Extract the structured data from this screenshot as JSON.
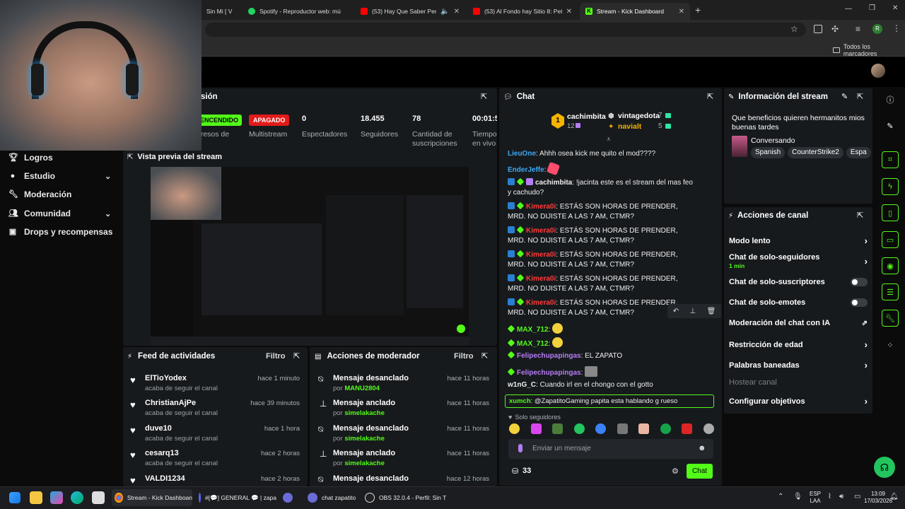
{
  "browser": {
    "tabs": [
      {
        "label": "Sin Mi [ V"
      },
      {
        "label": "Spotify - Reproductor web: mú"
      },
      {
        "label": "(53) Hay Que Saber Perder"
      },
      {
        "label": "(53) Al Fondo hay Sitio 8: Peter"
      },
      {
        "label": "Stream - Kick Dashboard"
      }
    ],
    "new_tab": "+",
    "bookmarks_folder": "Todos los marcadores",
    "profile_initial": "R"
  },
  "nav": {
    "items": [
      {
        "label": "Logros"
      },
      {
        "label": "Estudio"
      },
      {
        "label": "Moderación"
      },
      {
        "label": "Comunidad"
      },
      {
        "label": "Drops y recompensas"
      }
    ]
  },
  "session": {
    "title": "sión",
    "stats": [
      {
        "value": "ENCENDIDO",
        "label": "gresos de"
      },
      {
        "value": "APAGADO",
        "label": "Multistream"
      },
      {
        "value": "0",
        "label": "Espectadores"
      },
      {
        "value": "18.455",
        "label": "Seguidores"
      },
      {
        "value": "78",
        "label": "Cantidad de suscripciones"
      },
      {
        "value": "00:01:5",
        "label": "Tiempo en vivo"
      }
    ]
  },
  "preview": {
    "title": "Vista previa del stream"
  },
  "feed": {
    "title": "Feed de actividades",
    "filter": "Filtro",
    "items": [
      {
        "name": "ElTioYodex",
        "action": "acaba de seguir el canal",
        "time": "hace 1 minuto"
      },
      {
        "name": "ChristianAjPe",
        "action": "acaba de seguir el canal",
        "time": "hace 39 minutos"
      },
      {
        "name": "duve10",
        "action": "acaba de seguir el canal",
        "time": "hace 1 hora"
      },
      {
        "name": "cesarq13",
        "action": "acaba de seguir el canal",
        "time": "hace 2 horas"
      },
      {
        "name": "VALDI1234",
        "action": "",
        "time": "hace 2 horas"
      }
    ]
  },
  "modactions": {
    "title": "Acciones de moderador",
    "filter": "Filtro",
    "items": [
      {
        "action": "Mensaje desanclado",
        "prefix": "por",
        "user": "MANU2804",
        "time": "hace 11 horas"
      },
      {
        "action": "Mensaje anclado",
        "prefix": "por",
        "user": "simelakache",
        "time": "hace 11 horas"
      },
      {
        "action": "Mensaje desanclado",
        "prefix": "por",
        "user": "simelakache",
        "time": "hace 11 horas"
      },
      {
        "action": "Mensaje anclado",
        "prefix": "por",
        "user": "simelakache",
        "time": "hace 11 horas"
      },
      {
        "action": "Mensaje desanclado",
        "prefix": "",
        "user": "",
        "time": "hace 12 horas"
      }
    ]
  },
  "chat": {
    "title": "Chat",
    "leaderboard": [
      {
        "rank": "1",
        "name": "cachimbita",
        "count": "12"
      },
      {
        "name": "vintagedota",
        "count": "7"
      },
      {
        "name": "navialt",
        "count": "5"
      }
    ],
    "messages": [
      {
        "user": "LieuOne",
        "color": "#3fa9f5",
        "text": "Ahhh osea kick me quito el mod????"
      },
      {
        "user": "EnderJeffe",
        "color": "#3fa9f5",
        "text": ""
      },
      {
        "user": "cachimbita",
        "color": "#ffffff",
        "text": "!jacinta este es el stream del mas feo y cachudo?"
      },
      {
        "user": "Kimera0i",
        "color": "#ff3b3b",
        "text": "ESTÁS SON HORAS DE PRENDER, MRD. NO DIJISTE A LAS 7 AM, CTMR?"
      },
      {
        "user": "Kimera0i",
        "color": "#ff3b3b",
        "text": "ESTÁS SON HORAS DE PRENDER, MRD. NO DIJISTE A LAS 7 AM, CTMR?"
      },
      {
        "user": "Kimera0i",
        "color": "#ff3b3b",
        "text": "ESTÁS SON HORAS DE PRENDER, MRD. NO DIJISTE A LAS 7 AM, CTMR?"
      },
      {
        "user": "Kimera0i",
        "color": "#ff3b3b",
        "text": "ESTÁS SON HORAS DE PRENDER, MRD. NO DIJISTE A LAS 7 AM, CTMR?"
      },
      {
        "user": "Kimera0i",
        "color": "#ff3b3b",
        "text": "ESTÁS SON HORAS DE PRENDER, MRD. NO DIJISTE A LAS 7 AM, CTMR?"
      },
      {
        "user": "MAX_712",
        "color": "#53fc18",
        "text": ""
      },
      {
        "user": "MAX_712",
        "color": "#53fc18",
        "text": ""
      },
      {
        "user": "Felipechupapingas",
        "color": "#b57cf3",
        "text": "EL ZAPATO"
      },
      {
        "user": "Felipechupapingas",
        "color": "#b57cf3",
        "text": ""
      },
      {
        "user": "w1nG_C",
        "color": "#ffffff",
        "text": "Cuando irl en el chongo con el gotto"
      }
    ],
    "highlight": {
      "user": "xumch",
      "text": "@ZapatitoGaming papita esta hablando g rueso"
    },
    "mode_label": "Solo seguidores",
    "input_placeholder": "Enviar un mensaje",
    "points": "33",
    "send": "Chat"
  },
  "info": {
    "title": "Información del stream",
    "stream_title": "Que beneficios quieren hermanitos mios buenas tardes",
    "category": "Conversando",
    "tags": [
      "Spanish",
      "CounterStrike2",
      "Espa"
    ]
  },
  "actions": {
    "title": "Acciones de canal",
    "items": [
      {
        "label": "Modo lento",
        "sub": "",
        "control": "chevron"
      },
      {
        "label": "Chat de solo-seguidores",
        "sub": "1 min",
        "control": "chevron"
      },
      {
        "label": "Chat de solo-suscriptores",
        "sub": "",
        "control": "toggle"
      },
      {
        "label": "Chat de solo-emotes",
        "sub": "",
        "control": "toggle"
      },
      {
        "label": "Moderación del chat con IA",
        "sub": "",
        "control": "external"
      },
      {
        "label": "Restricción de edad",
        "sub": "",
        "control": "chevron"
      },
      {
        "label": "Palabras baneadas",
        "sub": "",
        "control": "chevron"
      },
      {
        "label": "Hostear canal",
        "sub": "",
        "control": "none"
      },
      {
        "label": "Configurar objetivos",
        "sub": "",
        "control": "chevron"
      }
    ]
  },
  "taskbar": {
    "apps": [
      {
        "label": "Stream - Kick Dashboan"
      },
      {
        "label": "#[💬] GENERAL 💬 | zapa"
      },
      {
        "label": "chat zapatito"
      },
      {
        "label": "OBS 32.0.4 - Perfil: Sin T"
      }
    ],
    "lang": "ESP",
    "lang2": "LAA",
    "time": "13:09",
    "date": "17/03/2026"
  },
  "colors": {
    "brand": "#53fc18",
    "panel": "#171a1d",
    "danger": "#e21a1a"
  }
}
